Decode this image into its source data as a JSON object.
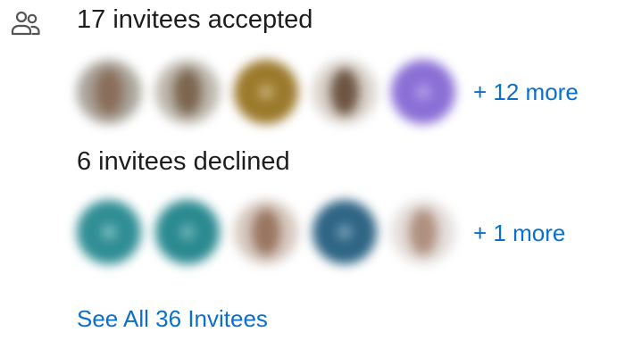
{
  "accepted": {
    "title": "17 invitees accepted",
    "more": "+ 12 more",
    "avatars": [
      {
        "icon": "photo-avatar",
        "bg": "#a9a39a",
        "face": "#8a6e5a"
      },
      {
        "icon": "photo-avatar",
        "bg": "#bdb8ae",
        "face": "#7d6650"
      },
      {
        "icon": "initials-avatar",
        "bg": "#9c7a2c",
        "face": "#c9b27a"
      },
      {
        "icon": "photo-avatar",
        "bg": "#d9d3cc",
        "face": "#6e5543"
      },
      {
        "icon": "initials-avatar",
        "bg": "#8b6fd6",
        "face": "#b6a3ea"
      }
    ]
  },
  "declined": {
    "title": "6 invitees declined",
    "more": "+ 1 more",
    "avatars": [
      {
        "icon": "initials-avatar",
        "bg": "#2f8e94",
        "face": "#7fc0c2"
      },
      {
        "icon": "initials-avatar",
        "bg": "#2a8a90",
        "face": "#74b8bb"
      },
      {
        "icon": "photo-avatar",
        "bg": "#d6c9c0",
        "face": "#9a7661"
      },
      {
        "icon": "initials-avatar",
        "bg": "#2f6585",
        "face": "#7aa4bd"
      },
      {
        "icon": "photo-avatar",
        "bg": "#e4dedb",
        "face": "#b09080"
      }
    ]
  },
  "footer": {
    "see_all": "See All 36 Invitees"
  },
  "colors": {
    "link": "#0a6fcf",
    "text": "#1d1d1f"
  }
}
